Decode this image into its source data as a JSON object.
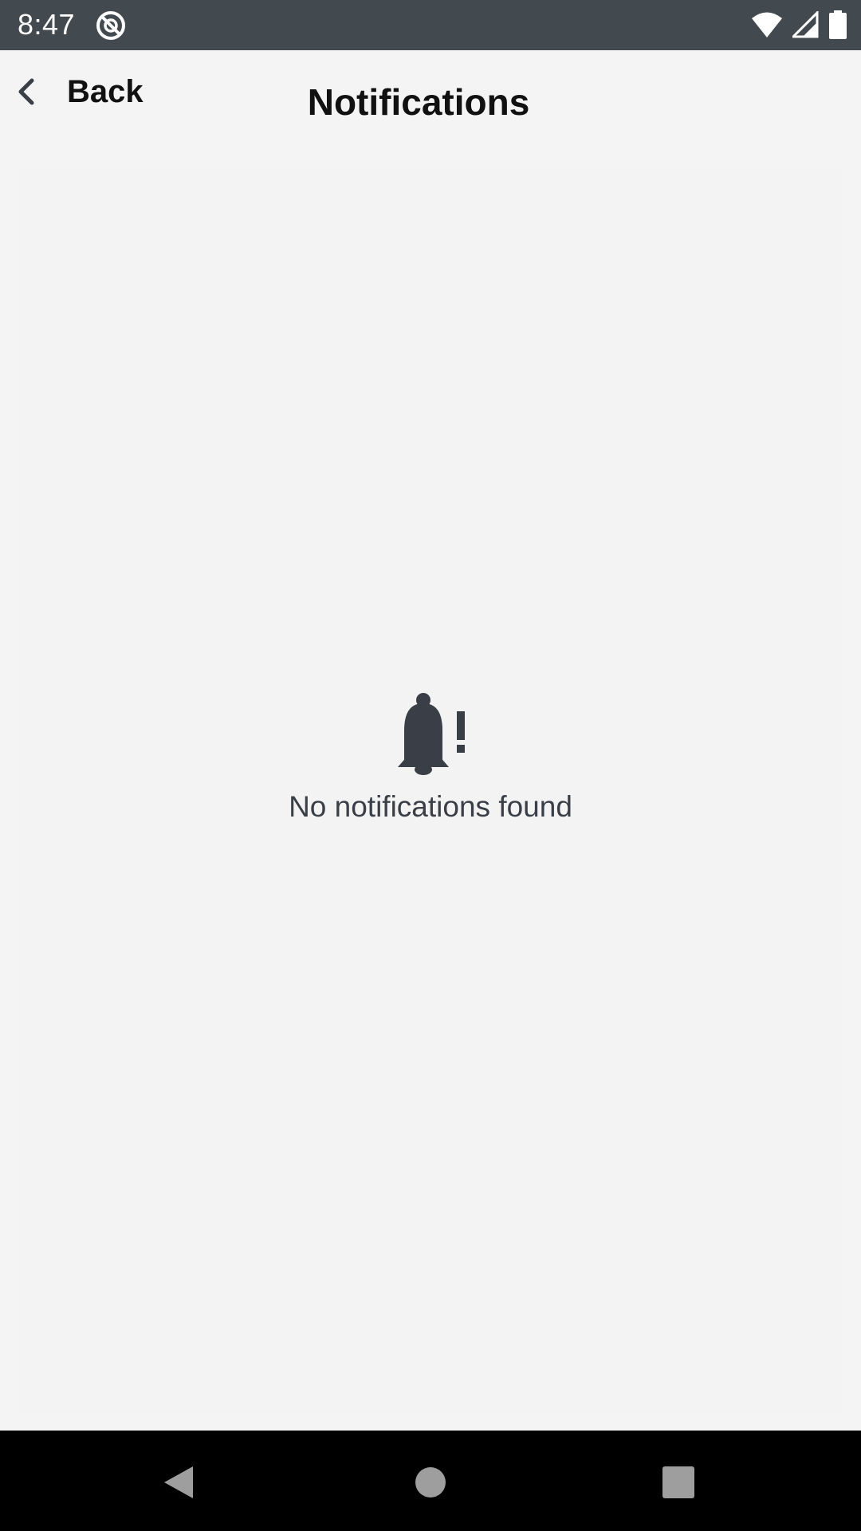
{
  "status_bar": {
    "time": "8:47",
    "icons": [
      "app-notification-icon",
      "wifi-icon",
      "cellular-signal-icon",
      "battery-icon"
    ]
  },
  "header": {
    "back_label": "Back",
    "title": "Notifications"
  },
  "empty_state": {
    "icon": "bell-alert-icon",
    "message": "No notifications found"
  },
  "nav_bar": {
    "buttons": [
      "back-triangle-icon",
      "home-circle-icon",
      "recents-square-icon"
    ]
  },
  "colors": {
    "status_bar_bg": "#434a4f",
    "background": "#f4f4f5",
    "icon_dark": "#3a3f47",
    "nav_bar_bg": "#000000",
    "nav_icon": "#9e9e9e"
  }
}
